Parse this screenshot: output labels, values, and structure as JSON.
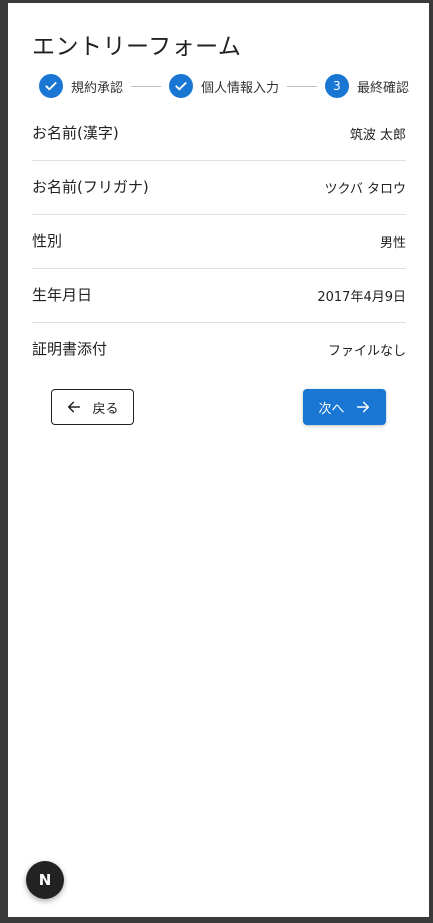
{
  "title": "エントリーフォーム",
  "stepper": {
    "steps": [
      {
        "label": "規約承認",
        "status": "completed",
        "icon": "check-icon"
      },
      {
        "label": "個人情報入力",
        "status": "completed",
        "icon": "check-icon"
      },
      {
        "label": "最終確認",
        "status": "active",
        "number": "3"
      }
    ]
  },
  "rows": [
    {
      "label": "お名前(漢字)",
      "value": "筑波 太郎"
    },
    {
      "label": "お名前(フリガナ)",
      "value": "ツクバ タロウ"
    },
    {
      "label": "性別",
      "value": "男性"
    },
    {
      "label": "生年月日",
      "value": "2017年4月9日"
    },
    {
      "label": "証明書添付",
      "value": "ファイルなし"
    }
  ],
  "buttons": {
    "back_label": "戻る",
    "back_icon": "arrow-left-icon",
    "next_label": "次へ",
    "next_icon": "arrow-right-icon"
  },
  "badge": {
    "label": "N",
    "icon": "nextjs-icon"
  },
  "colors": {
    "accent": "#1976d2",
    "background": "#3a3a3a",
    "text": "#212121",
    "divider": "#e0e0e0"
  }
}
